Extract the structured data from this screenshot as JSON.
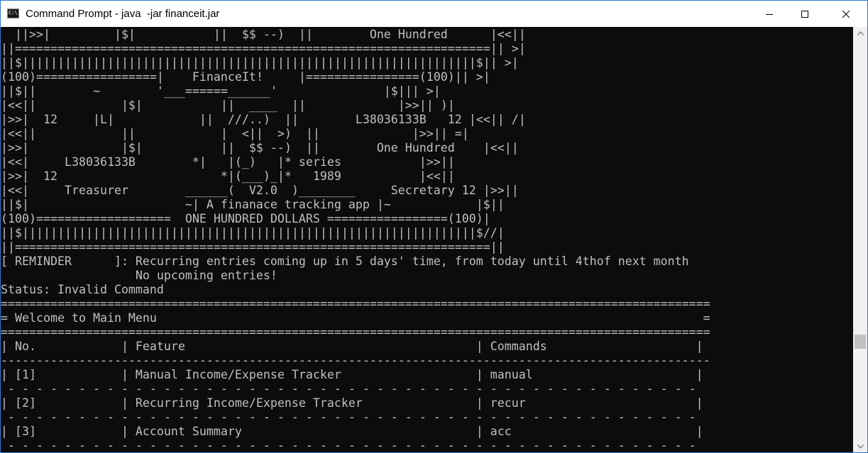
{
  "window": {
    "title": "Command Prompt - java  -jar financeit.jar",
    "icon_label": "C:\\",
    "controls": {
      "minimize": "minimize-icon",
      "maximize": "maximize-icon",
      "close": "close-icon"
    }
  },
  "console": {
    "lines": [
      "  ||>>|         |$|           ||  $$ --)  ||        One Hundred      |<<||",
      "||===================================================================|| >|",
      "||$||||||||||||||||||||||||||||||||||||||||||||||||||||||||||||||||$|| >|",
      "(100)=================|    FinanceIt!     |================(100)|| >|",
      "||$||        ~        '___======______'               |$||| >|",
      "|<<||            |$|           ||  ____  ||             |>>|| )|",
      "|>>|  12     |L|            ||  ///..)  ||        L38036133B   12 |<<|| /|",
      "|<<||            ||            |  <||  >)  ||             |>>|| =|",
      "|>>|             |$|           ||  $$ --)  ||        One Hundred    |<<||",
      "|<<|     L38036133B        *|   |(_)   |* series           |>>||",
      "|>>|  12                       *|(___)_|*   1989           |<<||",
      "|<<|     Treasurer        ______(  V2.0  )________     Secretary 12 |>>||",
      "||$|                      ~| A finanace tracking app |~            |$||",
      "(100)===================  ONE HUNDRED DOLLARS =================(100)|",
      "||$||||||||||||||||||||||||||||||||||||||||||||||||||||||||||||||||$//|",
      "||===================================================================||",
      "[ REMINDER      ]: Recurring entries coming up in 5 days' time, from today until 4thof next month",
      "                   No upcoming entries!",
      "Status: Invalid Command",
      "====================================================================================================",
      "= Welcome to Main Menu                                                                             =",
      "====================================================================================================",
      "| No.            | Feature                                         | Commands                     |",
      "----------------------------------------------------------------------------------------------------",
      "| [1]            | Manual Income/Expense Tracker                   | manual                       |",
      " - - - - - - - - - - - - - - - - - - - - - - - - - - - - - - - - - - - - - - - - - - - - - - - - - ",
      "| [2]            | Recurring Income/Expense Tracker                | recur                        |",
      " - - - - - - - - - - - - - - - - - - - - - - - - - - - - - - - - - - - - - - - - - - - - - - - - - ",
      "| [3]            | Account Summary                                 | acc                          |",
      " - - - - - - - - - - - - - - - - - - - - - - - - - - - - - - - - - - - - - - - - - - - - - - - - - "
    ]
  }
}
